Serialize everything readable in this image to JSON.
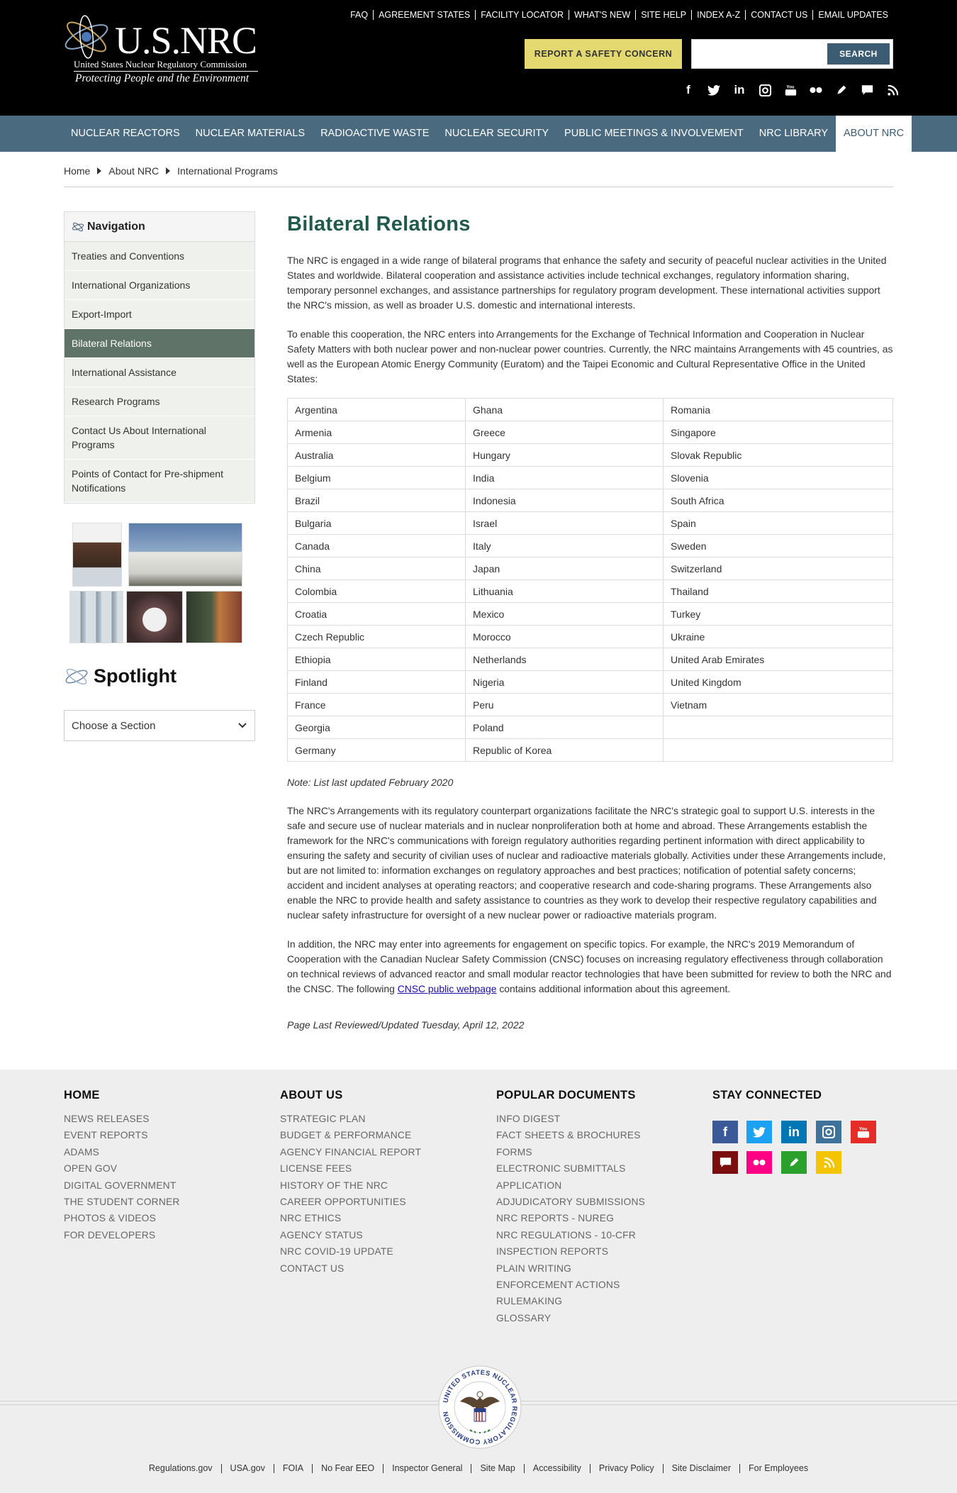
{
  "header": {
    "logo_title": "U.S.NRC",
    "logo_subtitle": "United States Nuclear Regulatory Commission",
    "logo_tagline": "Protecting People and the Environment",
    "utility_links": [
      "FAQ",
      "AGREEMENT STATES",
      "FACILITY LOCATOR",
      "WHAT'S NEW",
      "SITE HELP",
      "INDEX A-Z",
      "CONTACT US",
      "EMAIL UPDATES"
    ],
    "report_button": "REPORT A SAFETY CONCERN",
    "search_placeholder": "",
    "search_button": "SEARCH",
    "social_icons": [
      "facebook-icon",
      "twitter-icon",
      "linkedin-icon",
      "instagram-icon",
      "youtube-icon",
      "flickr-icon",
      "pencil-icon",
      "chat-icon",
      "rss-icon"
    ]
  },
  "nav": {
    "items": [
      "NUCLEAR REACTORS",
      "NUCLEAR MATERIALS",
      "RADIOACTIVE WASTE",
      "NUCLEAR SECURITY",
      "PUBLIC MEETINGS & INVOLVEMENT",
      "NRC LIBRARY",
      "ABOUT NRC"
    ],
    "active": "ABOUT NRC"
  },
  "breadcrumb": [
    "Home",
    "About NRC",
    "International Programs"
  ],
  "sidebar": {
    "heading": "Navigation",
    "items": [
      "Treaties and Conventions",
      "International Organizations",
      "Export-Import",
      "Bilateral Relations",
      "International Assistance",
      "Research Programs",
      "Contact Us About International Programs",
      "Points of Contact for Pre-shipment Notifications"
    ],
    "active": "Bilateral Relations",
    "spotlight": "Spotlight",
    "choose": "Choose a Section"
  },
  "main": {
    "title": "Bilateral Relations",
    "p1": "The NRC is engaged in a wide range of bilateral programs that enhance the safety and security of peaceful nuclear activities in the United States and worldwide. Bilateral cooperation and assistance activities include technical exchanges, regulatory information sharing, temporary personnel exchanges, and assistance partnerships for regulatory program development. These international activities support the NRC's mission, as well as broader U.S. domestic and international interests.",
    "p2": "To enable this cooperation, the NRC enters into Arrangements for the Exchange of Technical Information and Cooperation in Nuclear Safety Matters with both nuclear power and non-nuclear power countries. Currently, the NRC maintains Arrangements with 45 countries, as well as the European Atomic Energy Community (Euratom) and the Taipei Economic and Cultural Representative Office in the United States:",
    "countries": [
      [
        "Argentina",
        "Ghana",
        "Romania"
      ],
      [
        "Armenia",
        "Greece",
        "Singapore"
      ],
      [
        "Australia",
        "Hungary",
        "Slovak Republic"
      ],
      [
        "Belgium",
        "India",
        "Slovenia"
      ],
      [
        "Brazil",
        "Indonesia",
        "South Africa"
      ],
      [
        "Bulgaria",
        "Israel",
        "Spain"
      ],
      [
        "Canada",
        "Italy",
        "Sweden"
      ],
      [
        "China",
        "Japan",
        "Switzerland"
      ],
      [
        "Colombia",
        "Lithuania",
        "Thailand"
      ],
      [
        "Croatia",
        "Mexico",
        "Turkey"
      ],
      [
        "Czech Republic",
        "Morocco",
        "Ukraine"
      ],
      [
        "Ethiopia",
        "Netherlands",
        "United Arab Emirates"
      ],
      [
        "Finland",
        "Nigeria",
        "United Kingdom"
      ],
      [
        "France",
        "Peru",
        "Vietnam"
      ],
      [
        "Georgia",
        "Poland",
        ""
      ],
      [
        "Germany",
        "Republic of Korea",
        ""
      ]
    ],
    "note": "Note: List last updated February 2020",
    "p3": "The NRC's Arrangements with its regulatory counterpart organizations facilitate the NRC's strategic goal to support U.S. interests in the safe and secure use of nuclear materials and in nuclear nonproliferation both at home and abroad. These Arrangements establish the framework for the NRC's communications with foreign regulatory authorities regarding pertinent information with direct applicability to ensuring the safety and security of civilian uses of nuclear and radioactive materials globally. Activities under these Arrangements include, but are not limited to: information exchanges on regulatory approaches and best practices; notification of potential safety concerns; accident and incident analyses at operating reactors; and cooperative research and code-sharing programs. These Arrangements also enable the NRC to provide health and safety assistance to countries as they work to develop their respective regulatory capabilities and nuclear safety infrastructure for oversight of a new nuclear power or radioactive materials program.",
    "p4_before": "In addition, the NRC may enter into agreements for engagement on specific topics. For example, the NRC's 2019 Memorandum of Cooperation with the Canadian Nuclear Safety Commission (CNSC) focuses on increasing regulatory effectiveness through collaboration on technical reviews of advanced reactor and small modular reactor technologies that have been submitted for review to both the NRC and the CNSC. The following ",
    "p4_link": "CNSC public webpage",
    "p4_after": " contains additional information about this agreement.",
    "reviewed": "Page Last Reviewed/Updated Tuesday, April 12, 2022"
  },
  "footer": {
    "home": {
      "title": "HOME",
      "links": [
        "NEWS RELEASES",
        "EVENT REPORTS",
        "ADAMS",
        "OPEN GOV",
        "DIGITAL GOVERNMENT",
        "THE STUDENT CORNER",
        "PHOTOS & VIDEOS",
        "FOR DEVELOPERS"
      ]
    },
    "about": {
      "title": "ABOUT US",
      "links": [
        "STRATEGIC PLAN",
        "BUDGET & PERFORMANCE",
        "AGENCY FINANCIAL REPORT",
        "LICENSE FEES",
        "HISTORY OF THE NRC",
        "CAREER OPPORTUNITIES",
        "NRC ETHICS",
        "AGENCY STATUS",
        "NRC COVID-19 UPDATE",
        "CONTACT US"
      ]
    },
    "docs": {
      "title": "POPULAR DOCUMENTS",
      "links": [
        "INFO DIGEST",
        "FACT SHEETS & BROCHURES",
        "FORMS",
        "ELECTRONIC SUBMITTALS",
        "APPLICATION",
        "ADJUDICATORY SUBMISSIONS",
        "NRC REPORTS - NUREG",
        "NRC REGULATIONS - 10-CFR",
        "INSPECTION REPORTS",
        "PLAIN WRITING",
        "ENFORCEMENT ACTIONS",
        "RULEMAKING",
        "GLOSSARY"
      ]
    },
    "connect": {
      "title": "STAY CONNECTED"
    },
    "social_colors": {
      "facebook": "#3b5998",
      "twitter": "#1da1f2",
      "linkedin": "#0077b5",
      "instagram": "#3f729b",
      "youtube": "#e52d27",
      "chat": "#7a0e0e",
      "flickr": "#ff0084",
      "pencil": "#2aa12a",
      "rss": "#f5c400"
    },
    "seal_text": "UNITED STATES NUCLEAR REGULATORY COMMISSION",
    "bottom_links": [
      "Regulations.gov",
      "USA.gov",
      "FOIA",
      "No Fear EEO",
      "Inspector General",
      "Site Map",
      "Accessibility",
      "Privacy Policy",
      "Site Disclaimer",
      "For Employees"
    ]
  }
}
